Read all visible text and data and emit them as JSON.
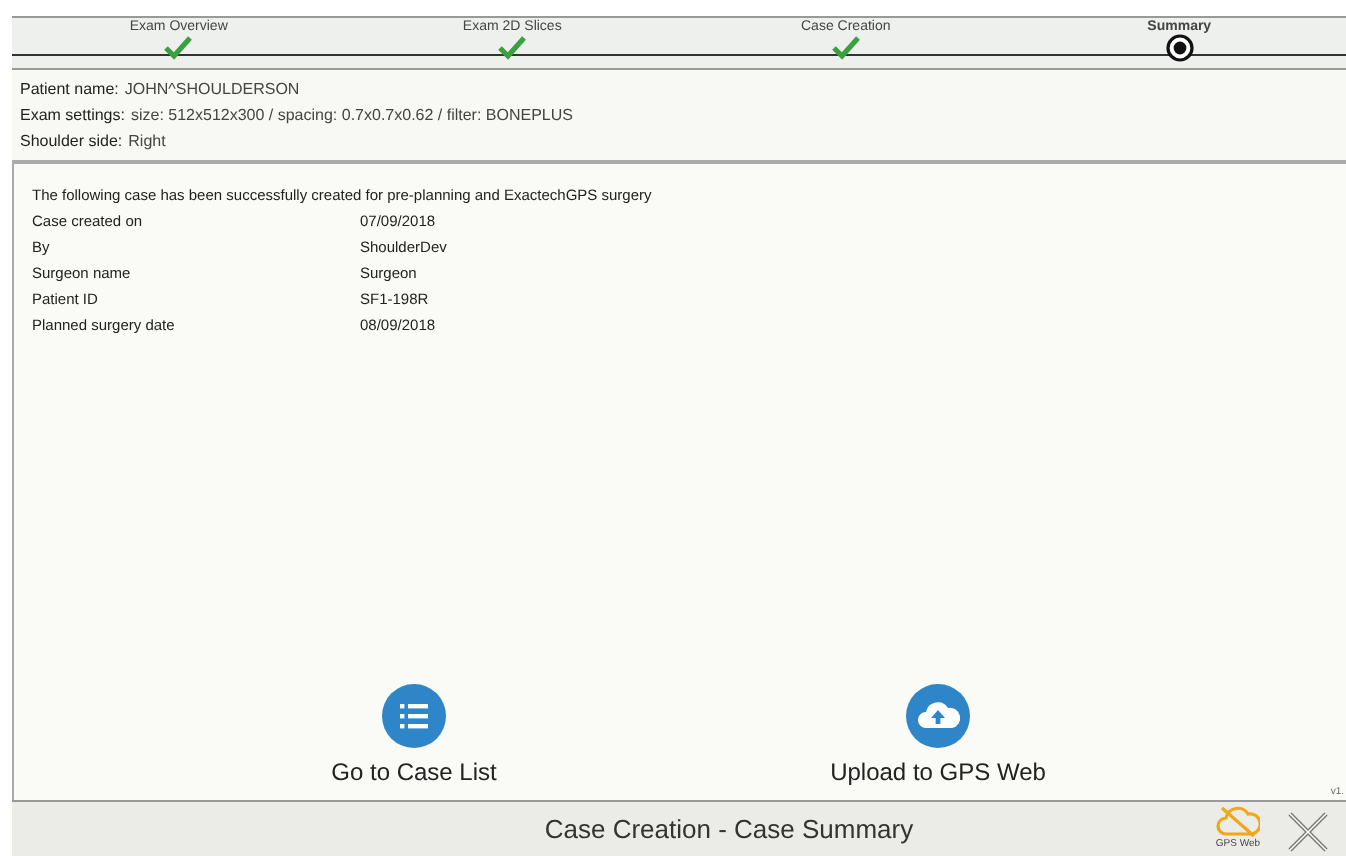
{
  "steps": [
    {
      "label": "Exam Overview",
      "completed": true,
      "selected": false
    },
    {
      "label": "Exam 2D Slices",
      "completed": true,
      "selected": false
    },
    {
      "label": "Case Creation",
      "completed": true,
      "selected": false
    },
    {
      "label": "Summary",
      "completed": false,
      "selected": true
    }
  ],
  "patient": [
    {
      "label": "Patient name:",
      "value": "JOHN^SHOULDERSON"
    },
    {
      "label": "Exam settings:",
      "value": "size: 512x512x300 / spacing: 0.7x0.7x0.62 / filter: BONEPLUS"
    },
    {
      "label": "Shoulder side:",
      "value": "Right"
    }
  ],
  "summary": {
    "intro": "The following case has been successfully created for pre-planning and ExactechGPS surgery",
    "rows": [
      {
        "label": "Case created on",
        "value": "07/09/2018"
      },
      {
        "label": "By",
        "value": "ShoulderDev"
      },
      {
        "label": "Surgeon name",
        "value": "Surgeon"
      },
      {
        "label": "Patient ID",
        "value": "SF1-198R"
      },
      {
        "label": "Planned surgery date",
        "value": "08/09/2018"
      }
    ]
  },
  "actions": [
    {
      "kind": "list",
      "label": "Go to Case List"
    },
    {
      "kind": "upload",
      "label": "Upload to GPS Web"
    }
  ],
  "version": "v1.",
  "footer": {
    "title": "Case Creation - Case Summary",
    "gps_label": "GPS Web",
    "gps_connected": false
  }
}
